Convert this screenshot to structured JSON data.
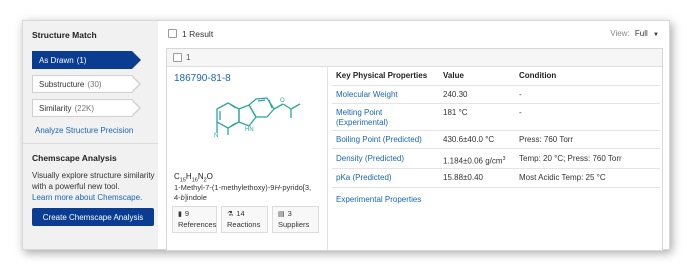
{
  "sidebar": {
    "structure_match_title": "Structure Match",
    "items": [
      {
        "label": "As Drawn",
        "count": "(1)",
        "active": true
      },
      {
        "label": "Substructure",
        "count": "(30)",
        "active": false
      },
      {
        "label": "Similarity",
        "count": "(22K)",
        "active": false
      }
    ],
    "analyze_link": "Analyze Structure Precision",
    "chemscape_title": "Chemscape Analysis",
    "chemscape_desc_1": "Visually explore structure similarity",
    "chemscape_desc_2": "with a powerful new tool.",
    "chemscape_link": "Learn more about Chemscape.",
    "create_button": "Create Chemscape Analysis"
  },
  "results": {
    "count_label": "1 Result",
    "view_label": "View:",
    "view_value": "Full",
    "row_index": "1"
  },
  "substance": {
    "cas_number": "186790-81-8",
    "formula": {
      "c": "C",
      "c_n": "15",
      "h": "H",
      "h_n": "16",
      "n": "N",
      "n_n": "2",
      "o": "O"
    },
    "name_line1": "1-Methyl-7-(1-methylethoxy)-9",
    "name_line1_h": "H",
    "name_line1_end": "-pyrido[3,",
    "name_line2_a": "4-",
    "name_line2_b": "b",
    "name_line2_c": "]indole",
    "chips": [
      {
        "icon": "document-icon",
        "value": "9",
        "label": "References"
      },
      {
        "icon": "flask-icon",
        "value": "14",
        "label": "Reactions"
      },
      {
        "icon": "cart-icon",
        "value": "3",
        "label": "Suppliers"
      }
    ]
  },
  "properties": {
    "headers": {
      "property": "Key Physical Properties",
      "value": "Value",
      "condition": "Condition"
    },
    "rows": [
      {
        "name": "Molecular Weight",
        "name2": "",
        "value": "240.30",
        "condition": "-"
      },
      {
        "name": "Melting Point",
        "name2": "(Experimental)",
        "value": "181 °C",
        "condition": "-"
      },
      {
        "name": "Boiling Point (Predicted)",
        "name2": "",
        "value": "430.6±40.0 °C",
        "condition": "Press: 760 Torr"
      },
      {
        "name": "Density (Predicted)",
        "name2": "",
        "value": "1.184±0.06 g/cm",
        "value_sup": "3",
        "condition": "Temp: 20 °C; Press: 760 Torr"
      },
      {
        "name": "pKa (Predicted)",
        "name2": "",
        "value": "15.88±0.40",
        "condition": "Most Acidic Temp: 25 °C"
      }
    ],
    "experimental_link": "Experimental Properties"
  },
  "colors": {
    "primary": "#0a3d91",
    "link": "#1a66b3",
    "molecule": "#2aa89c"
  }
}
